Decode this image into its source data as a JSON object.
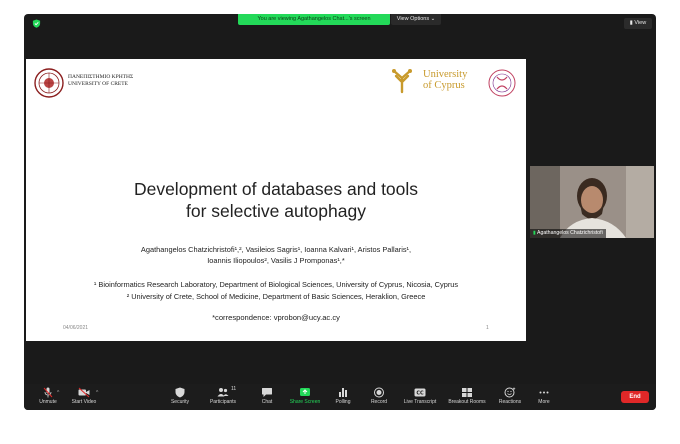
{
  "banner": {
    "text": "You are viewing Agathangelos Chat...'s screen",
    "view_options": "View Options ⌄"
  },
  "view_button": "View",
  "slide": {
    "crete_line1": "ΠΑΝΕΠΙΣΤΗΜΙΟ ΚΡΗΤΗΣ",
    "crete_line2": "UNIVERSITY OF CRETE",
    "cyprus_line1": "University",
    "cyprus_line2": "of Cyprus",
    "title_line1": "Development of databases and tools",
    "title_line2": "for selective autophagy",
    "authors_line1": "Agathangelos Chatzichristofi¹,², Vasileios Sagris¹, Ioanna Kalvari¹, Aristos Pallaris¹,",
    "authors_line2": "Ioannis Iliopoulos², Vasilis J Promponas¹,*",
    "affil_line1": "¹ Bioinformatics Research Laboratory, Department of Biological Sciences, University of Cyprus, Nicosia, Cyprus",
    "affil_line2": "² University of Crete, School of Medicine, Department of Basic Sciences, Heraklion, Greece",
    "correspondence": "*correspondence: vprobon@ucy.ac.cy",
    "date": "04/06/2021",
    "page": "1"
  },
  "participant_name": "Agathangelos Chatzichristofi",
  "toolbar": {
    "unmute": "Unmute",
    "start_video": "Start Video",
    "security": "Security",
    "participants": "Participants",
    "participants_count": "11",
    "chat": "Chat",
    "share_screen": "Share Screen",
    "polling": "Polling",
    "record": "Record",
    "live_transcript": "Live Transcript",
    "breakout_rooms": "Breakout Rooms",
    "reactions": "Reactions",
    "more": "More",
    "end": "End"
  },
  "colors": {
    "share_green": "#23d959",
    "end_red": "#e02828",
    "cyprus_gold": "#c89a2c"
  }
}
